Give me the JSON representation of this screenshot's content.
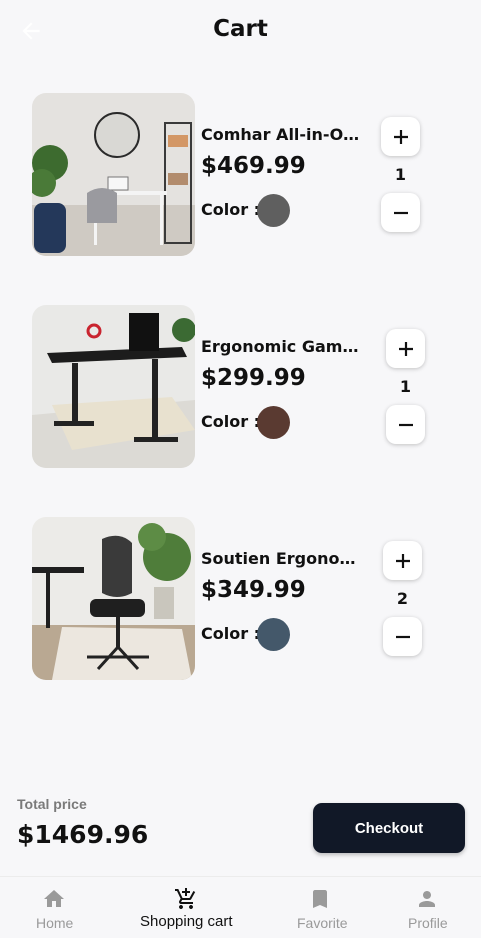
{
  "header": {
    "title": "Cart",
    "back_icon": "arrow-left-icon"
  },
  "items": [
    {
      "name": "Comhar All-in-One Glass Desk",
      "price": "$469.99",
      "color_label": "Color :",
      "color": "#5f5f5f",
      "quantity": "1"
    },
    {
      "name": "Ergonomic Gaming Desk",
      "price": "$299.99",
      "color_label": "Color :",
      "color": "#5a3a31",
      "quantity": "1"
    },
    {
      "name": "Soutien Ergonomic Chair",
      "price": "$349.99",
      "color_label": "Color :",
      "color": "#44586a",
      "quantity": "2"
    }
  ],
  "summary": {
    "total_label": "Total price",
    "total_value": "$1469.96",
    "checkout_label": "Checkout"
  },
  "nav": [
    {
      "label": "Home",
      "icon": "home-icon",
      "active": false
    },
    {
      "label": "Shopping cart",
      "icon": "cart-plus-icon",
      "active": true
    },
    {
      "label": "Favorite",
      "icon": "bookmark-icon",
      "active": false
    },
    {
      "label": "Profile",
      "icon": "person-icon",
      "active": false
    }
  ],
  "colors": {
    "accent": "#111827",
    "background": "#f7f7f9",
    "inactive": "#9a9a9a"
  }
}
